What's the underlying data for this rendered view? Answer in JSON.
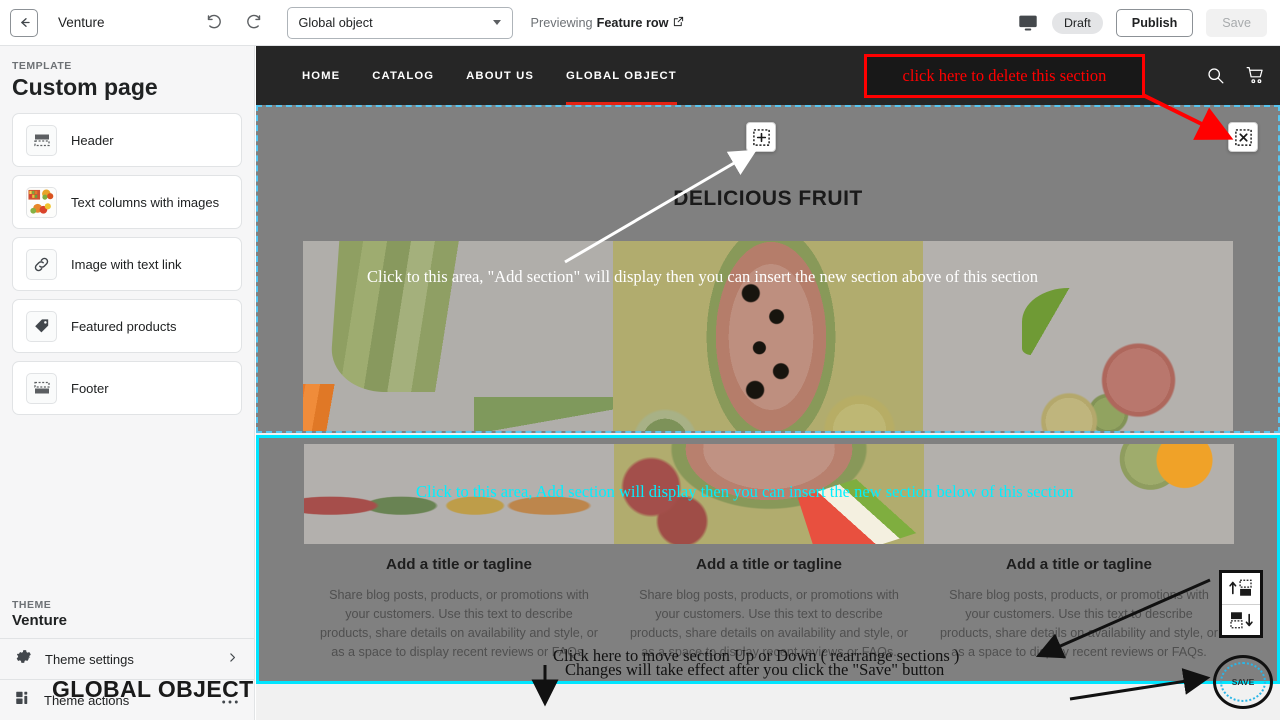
{
  "topbar": {
    "back_icon": "back-arrow-icon",
    "shop_title": "Venture",
    "undo_icon": "undo-icon",
    "redo_icon": "redo-icon",
    "template_select_value": "Global object",
    "previewing_prefix": "Previewing",
    "previewing_target": "Feature row",
    "external_link_icon": "external-link-icon",
    "device_icon": "desktop-icon",
    "draft_badge": "Draft",
    "publish_label": "Publish",
    "save_label": "Save"
  },
  "sidebar": {
    "section_label": "TEMPLATE",
    "page_name": "Custom page",
    "items": [
      {
        "label": "Header",
        "icon": "header-layout-icon"
      },
      {
        "label": "Text columns with images",
        "icon": "image-thumbnail-icon"
      },
      {
        "label": "Image with text link",
        "icon": "link-icon"
      },
      {
        "label": "Featured products",
        "icon": "tag-icon"
      },
      {
        "label": "Footer",
        "icon": "footer-layout-icon"
      }
    ],
    "theme_label": "THEME",
    "theme_name": "Venture",
    "theme_settings": "Theme settings",
    "theme_settings_icon": "gear-icon",
    "theme_settings_chevron": "chevron-right-icon",
    "theme_actions": "Theme actions",
    "theme_actions_icon": "blocks-icon",
    "theme_actions_more": "ellipsis-icon"
  },
  "preview": {
    "nav": [
      {
        "label": "HOME",
        "active": false
      },
      {
        "label": "CATALOG",
        "active": false
      },
      {
        "label": "ABOUT US",
        "active": false
      },
      {
        "label": "GLOBAL OBJECT",
        "active": true
      }
    ],
    "search_icon": "search-icon",
    "cart_icon": "shopping-cart-icon",
    "section_one_title": "DELICIOUS FRUIT",
    "columns": [
      {
        "title": "Add a title or tagline",
        "body": "Share blog posts, products, or promotions with your customers. Use this text to describe products, share details on availability and style, or as a space to display recent reviews or FAQs."
      },
      {
        "title": "Add a title or tagline",
        "body": "Share blog posts, products, or promotions with your customers. Use this text to describe products, share details on availability and style, or as a space to display recent reviews or FAQs."
      },
      {
        "title": "Add a title or tagline",
        "body": "Share blog posts, products, or promotions with your customers. Use this text to describe products, share details on availability and style, or as a space to display recent reviews or FAQs."
      }
    ],
    "footer_title": "GLOBAL OBJECT"
  },
  "controls": {
    "add_section_icon": "add-section-icon",
    "delete_section_icon": "delete-section-icon",
    "move_up_icon": "move-section-up-icon",
    "move_down_icon": "move-section-down-icon"
  },
  "annotations": {
    "delete_box": "click here to delete this section",
    "add_above": "Click to this area, \"Add section\" will display then you can insert the new section above of this section",
    "add_below": "Click to this area, Add section will display then you can insert the new section below of this section",
    "move_updown": "Click here to move section Up or Down ( rearrange sections )",
    "save_note": "Changes will take effect after you click the \"Save\" button",
    "save_circle_label": "SAVE"
  },
  "colors": {
    "annotation_red": "#ff0000",
    "annotation_cyan": "#00f0ff",
    "selected_section_border": "#56c5f0",
    "hover_section_border": "#00e5ff",
    "nav_active_underline": "#e42313",
    "store_header_bg": "#262626"
  }
}
